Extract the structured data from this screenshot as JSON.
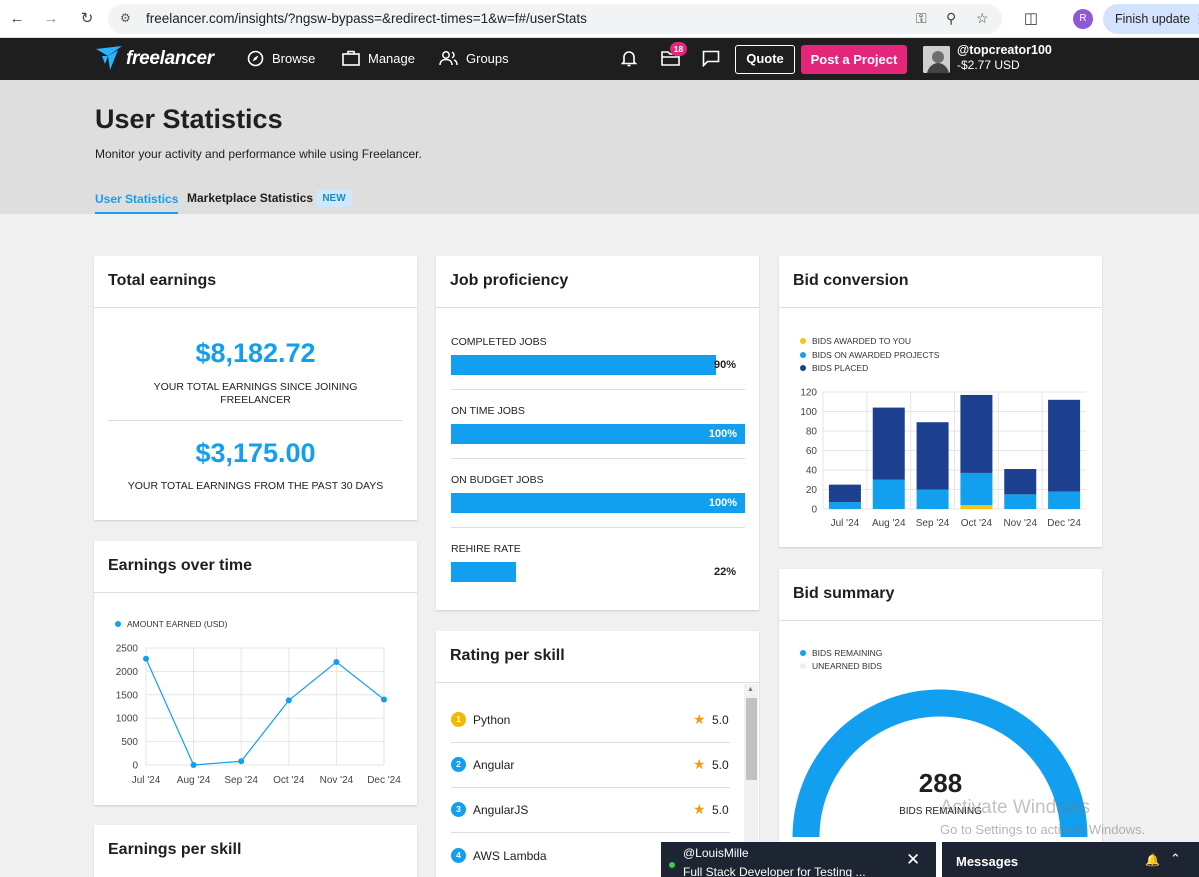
{
  "browser": {
    "url": "freelancer.com/insights/?ngsw-bypass=&redirect-times=1&w=f#/userStats",
    "profile_initial": "R",
    "finish_update_label": "Finish update"
  },
  "topnav": {
    "logo_text": "freelancer",
    "browse_label": "Browse",
    "manage_label": "Manage",
    "groups_label": "Groups",
    "projects_badge": "18",
    "quote_label": "Quote",
    "post_label": "Post a Project",
    "username": "@topcreator100",
    "balance": "-$2.77 USD"
  },
  "header": {
    "title": "User Statistics",
    "subtitle": "Monitor your activity and performance while using Freelancer.",
    "tab_user": "User Statistics",
    "tab_market": "Marketplace Statistics",
    "new_badge": "NEW"
  },
  "total_earnings": {
    "title": "Total earnings",
    "all_time_value": "$8,182.72",
    "all_time_caption_1": "YOUR TOTAL EARNINGS SINCE JOINING",
    "all_time_caption_2": "FREELANCER",
    "recent_value": "$3,175.00",
    "recent_caption": "YOUR TOTAL EARNINGS FROM THE PAST 30 DAYS"
  },
  "job_proficiency": {
    "title": "Job proficiency",
    "items": [
      {
        "label": "COMPLETED JOBS",
        "value_text": "90%",
        "value": 90
      },
      {
        "label": "ON TIME JOBS",
        "value_text": "100%",
        "value": 100
      },
      {
        "label": "ON BUDGET JOBS",
        "value_text": "100%",
        "value": 100
      },
      {
        "label": "REHIRE RATE",
        "value_text": "22%",
        "value": 22
      }
    ]
  },
  "rating_per_skill": {
    "title": "Rating per skill",
    "items": [
      {
        "rank": "1",
        "name": "Python",
        "score": "5.0",
        "color": "#f5b800"
      },
      {
        "rank": "2",
        "name": "Angular",
        "score": "5.0",
        "color": "#139ff0"
      },
      {
        "rank": "3",
        "name": "AngularJS",
        "score": "5.0",
        "color": "#139ff0"
      },
      {
        "rank": "4",
        "name": "AWS Lambda",
        "score": "",
        "color": "#139ff0"
      }
    ]
  },
  "earnings_per_skill": {
    "title": "Earnings per skill"
  },
  "bid_summary": {
    "title": "Bid summary",
    "legend": [
      "BIDS REMAINING",
      "UNEARNED BIDS"
    ],
    "remaining_value": "288",
    "remaining_label": "BIDS REMAINING"
  },
  "chat": {
    "user": "@LouisMille",
    "preview": "Full Stack Developer for Testing ...",
    "messages_label": "Messages"
  },
  "watermark": {
    "line1": "Activate Windows",
    "line2": "Go to Settings to activate Windows."
  },
  "colors": {
    "accent": "#139ff0",
    "brand_pink": "#e4267a",
    "dark_navy": "#1c3f8f",
    "gold": "#f5c518"
  },
  "chart_data": [
    {
      "type": "line",
      "title": "Earnings over time",
      "series": [
        {
          "name": "AMOUNT EARNED (USD)",
          "values": [
            2270,
            0,
            80,
            1380,
            2200,
            1400
          ]
        }
      ],
      "categories": [
        "Jul '24",
        "Aug '24",
        "Sep '24",
        "Oct '24",
        "Nov '24",
        "Dec '24"
      ],
      "ylim": [
        0,
        2500
      ],
      "yticks": [
        "0",
        "500",
        "1000",
        "1500",
        "2000",
        "2500"
      ],
      "grid": true,
      "legend": "top-left"
    },
    {
      "type": "bar",
      "title": "Bid conversion",
      "categories": [
        "Jul '24",
        "Aug '24",
        "Sep '24",
        "Oct '24",
        "Nov '24",
        "Dec '24"
      ],
      "series": [
        {
          "name": "BIDS AWARDED TO YOU",
          "values": [
            0,
            0,
            0,
            4,
            0,
            0
          ],
          "color": "#f5c518"
        },
        {
          "name": "BIDS ON AWARDED PROJECTS",
          "values": [
            7,
            30,
            20,
            33,
            15,
            18
          ],
          "color": "#139ff0"
        },
        {
          "name": "BIDS PLACED",
          "values": [
            18,
            74,
            69,
            80,
            26,
            94
          ],
          "color": "#1c3f8f"
        }
      ],
      "stacked": true,
      "ylim": [
        0,
        120
      ],
      "yticks": [
        "0",
        "20",
        "40",
        "60",
        "80",
        "100",
        "120"
      ],
      "grid": true,
      "legend": "top-left"
    }
  ]
}
